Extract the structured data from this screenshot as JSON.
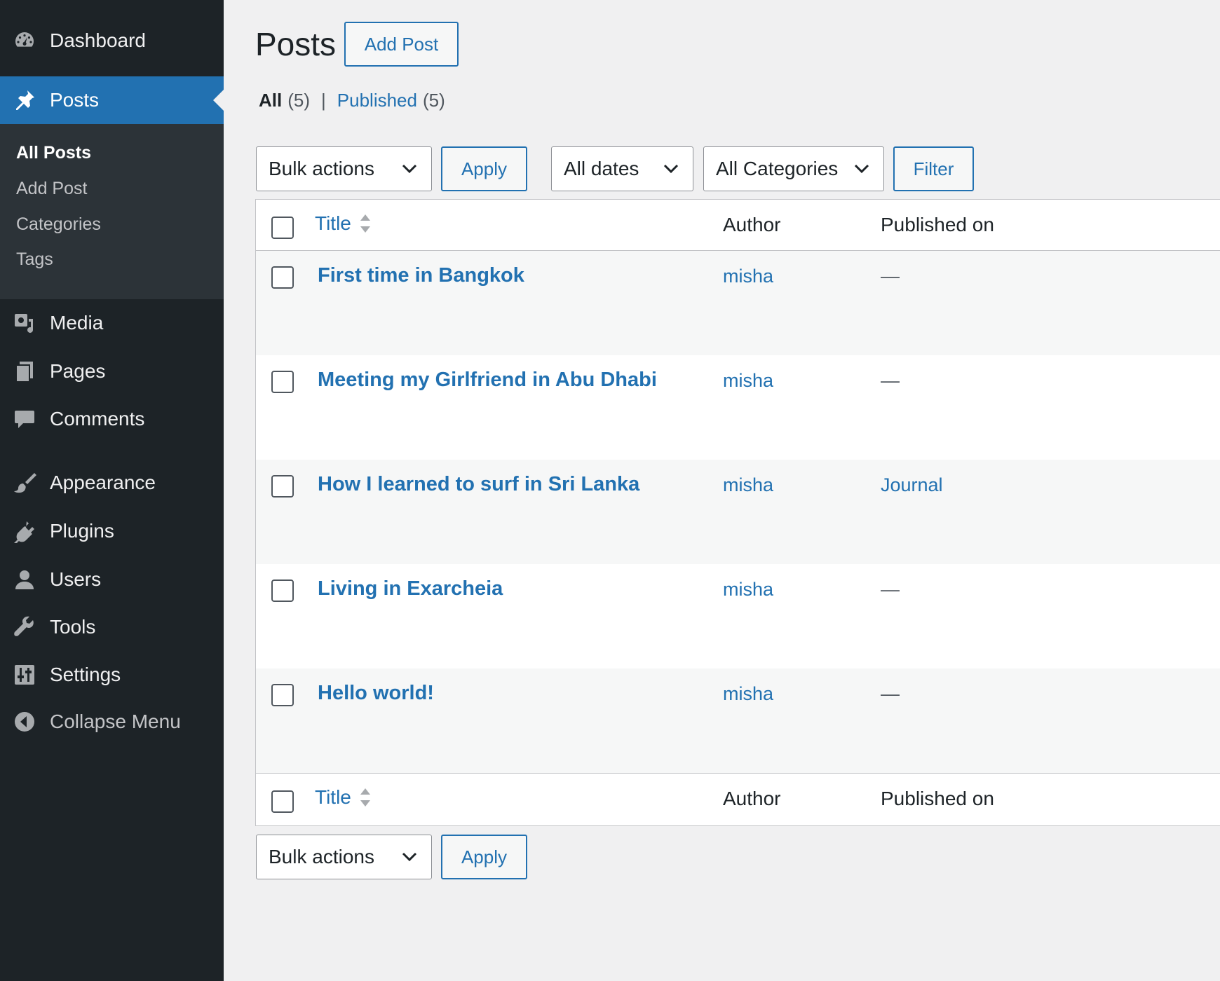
{
  "sidebar": {
    "items": [
      {
        "label": "Dashboard",
        "icon": "dashboard-icon"
      },
      {
        "label": "Posts",
        "icon": "pushpin-icon"
      },
      {
        "label": "Media",
        "icon": "media-icon"
      },
      {
        "label": "Pages",
        "icon": "pages-icon"
      },
      {
        "label": "Comments",
        "icon": "comment-icon"
      },
      {
        "label": "Appearance",
        "icon": "paintbrush-icon"
      },
      {
        "label": "Plugins",
        "icon": "plugin-icon"
      },
      {
        "label": "Users",
        "icon": "user-icon"
      },
      {
        "label": "Tools",
        "icon": "wrench-icon"
      },
      {
        "label": "Settings",
        "icon": "settings-sliders-icon"
      },
      {
        "label": "Collapse Menu",
        "icon": "collapse-arrow-icon"
      }
    ],
    "submenu": [
      "All Posts",
      "Add Post",
      "Categories",
      "Tags"
    ]
  },
  "header": {
    "title": "Posts",
    "add_button": "Add Post"
  },
  "views": {
    "all_label": "All",
    "all_count": "(5)",
    "separator": "|",
    "published_label": "Published",
    "published_count": "(5)"
  },
  "filters": {
    "bulk_actions": "Bulk actions",
    "apply": "Apply",
    "dates": "All dates",
    "categories": "All Categories",
    "filter": "Filter"
  },
  "table": {
    "columns": [
      "Title",
      "Author",
      "Published on"
    ],
    "rows": [
      {
        "title": "First time in Bangkok",
        "author": "misha",
        "published_on": "—"
      },
      {
        "title": "Meeting my Girlfriend in Abu Dhabi",
        "author": "misha",
        "published_on": "—"
      },
      {
        "title": "How I learned to surf in Sri Lanka",
        "author": "misha",
        "published_on": "Journal"
      },
      {
        "title": "Living in Exarcheia",
        "author": "misha",
        "published_on": "—"
      },
      {
        "title": "Hello world!",
        "author": "misha",
        "published_on": "—"
      }
    ]
  },
  "colors": {
    "sidebar_bg": "#1d2327",
    "submenu_bg": "#2c3338",
    "accent": "#2271b1",
    "page_bg": "#f0f0f1"
  }
}
